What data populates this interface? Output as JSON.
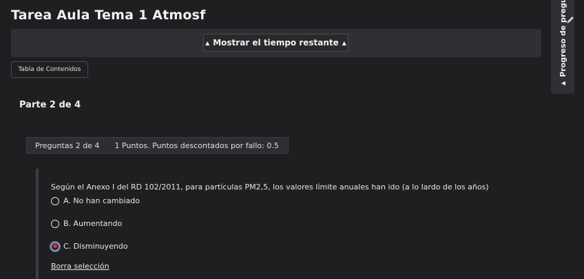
{
  "page": {
    "title": "Tarea Aula Tema 1 Atmosf"
  },
  "timer": {
    "button_label": "Mostrar el tiempo restante",
    "arrow": "▲"
  },
  "toc": {
    "label": "Tabla de Contenidos"
  },
  "part": {
    "title": "Parte 2 de 4"
  },
  "question": {
    "number_label": "Preguntas 2 de 4",
    "points_label": "1 Puntos. Puntos descontados por fallo: 0.5",
    "text": "Según el Anexo I del RD 102/2011, para partículas PM2,5, los valores límite anuales han ido (a lo lardo de los años)",
    "options": [
      {
        "label": "A. No han cambiado",
        "selected": false
      },
      {
        "label": "B. Aumentando",
        "selected": false
      },
      {
        "label": "C. Disminuyendo",
        "selected": true
      }
    ],
    "clear_label": "Borra selección"
  },
  "progress_panel": {
    "label": "Progreso de pregu",
    "arrow": "▲",
    "icon": "pencil-icon"
  },
  "colors": {
    "background": "#1e1f21",
    "panel": "#2e3033",
    "selected_radio": "#e0312f"
  }
}
